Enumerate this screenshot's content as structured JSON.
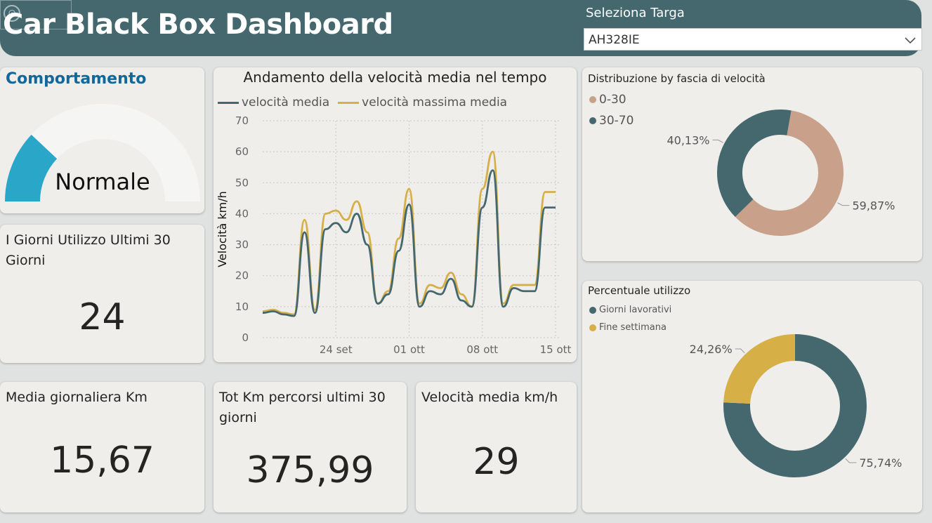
{
  "header": {
    "title": "Car Black Box Dashboard",
    "slicer_label": "Seleziona Targa",
    "slicer_value": "AH328IE"
  },
  "gauge": {
    "title": "Comportamento",
    "value_label": "Normale",
    "fill_fraction": 0.24,
    "fill_color": "#2aa6c8"
  },
  "kpis": {
    "giorni": {
      "title": "I Giorni Utilizzo Ultimi 30 Giorni",
      "value": "24"
    },
    "media_km": {
      "title": "Media giornaliera Km",
      "value": "15,67"
    },
    "tot_km": {
      "title": "Tot Km percorsi ultimi 30 giorni",
      "value": "375,99"
    },
    "velocita": {
      "title": "Velocità media km/h",
      "value": "29"
    }
  },
  "line_chart": {
    "title": "Andamento della velocità media nel tempo",
    "ylabel": "Velocità km/h",
    "series_labels": [
      "velocità media",
      "velocità massima media"
    ],
    "yticks": [
      "0",
      "10",
      "20",
      "30",
      "40",
      "50",
      "60",
      "70"
    ],
    "xticks": [
      "24 set",
      "01 ott",
      "08 ott",
      "15 ott"
    ],
    "colors": [
      "#45686f",
      "#d6af47"
    ]
  },
  "donut_speed": {
    "title": "Distribuzione by fascia di velocità",
    "legend": [
      "0-30",
      "30-70"
    ],
    "colors": [
      "#c9a18a",
      "#45686f"
    ],
    "labels": [
      "59,87%",
      "40,13%"
    ]
  },
  "donut_usage": {
    "title": "Percentuale utilizzo",
    "legend": [
      "Giorni lavorativi",
      "Fine settimana"
    ],
    "colors": [
      "#45686f",
      "#d6af47"
    ],
    "labels": [
      "75,74%",
      "24,26%"
    ]
  },
  "chart_data": [
    {
      "type": "line",
      "title": "Andamento della velocità media nel tempo",
      "ylabel": "Velocità km/h",
      "ylim": [
        0,
        70
      ],
      "x": [
        "17 set",
        "18 set",
        "19 set",
        "20 set",
        "21 set",
        "22 set",
        "23 set",
        "24 set",
        "25 set",
        "26 set",
        "27 set",
        "28 set",
        "29 set",
        "30 set",
        "01 ott",
        "02 ott",
        "03 ott",
        "04 ott",
        "05 ott",
        "06 ott",
        "07 ott",
        "08 ott",
        "09 ott",
        "10 ott",
        "11 ott",
        "12 ott",
        "13 ott",
        "14 ott",
        "15 ott"
      ],
      "series": [
        {
          "name": "velocità media",
          "values": [
            8,
            8.5,
            7.5,
            7,
            34,
            8,
            35,
            37,
            34,
            40,
            30,
            11,
            14,
            28,
            43,
            10,
            15,
            14,
            19,
            12,
            10,
            42,
            54,
            10,
            16,
            15,
            15,
            42,
            42
          ]
        },
        {
          "name": "velocità massima media",
          "values": [
            8.5,
            9,
            8,
            7.5,
            38,
            9,
            40,
            41,
            38,
            44,
            34,
            11,
            15,
            32,
            48,
            11,
            17,
            16,
            21,
            14,
            10,
            48,
            60,
            11,
            17,
            17,
            17,
            47,
            47
          ]
        }
      ],
      "xticks": [
        "24 set",
        "01 ott",
        "08 ott",
        "15 ott"
      ],
      "grid": true,
      "legend": "top-left"
    },
    {
      "type": "pie",
      "title": "Distribuzione by fascia di velocità",
      "categories": [
        "0-30",
        "30-70"
      ],
      "values": [
        59.87,
        40.13
      ]
    },
    {
      "type": "pie",
      "title": "Percentuale utilizzo",
      "categories": [
        "Giorni lavorativi",
        "Fine settimana"
      ],
      "values": [
        75.74,
        24.26
      ]
    }
  ]
}
